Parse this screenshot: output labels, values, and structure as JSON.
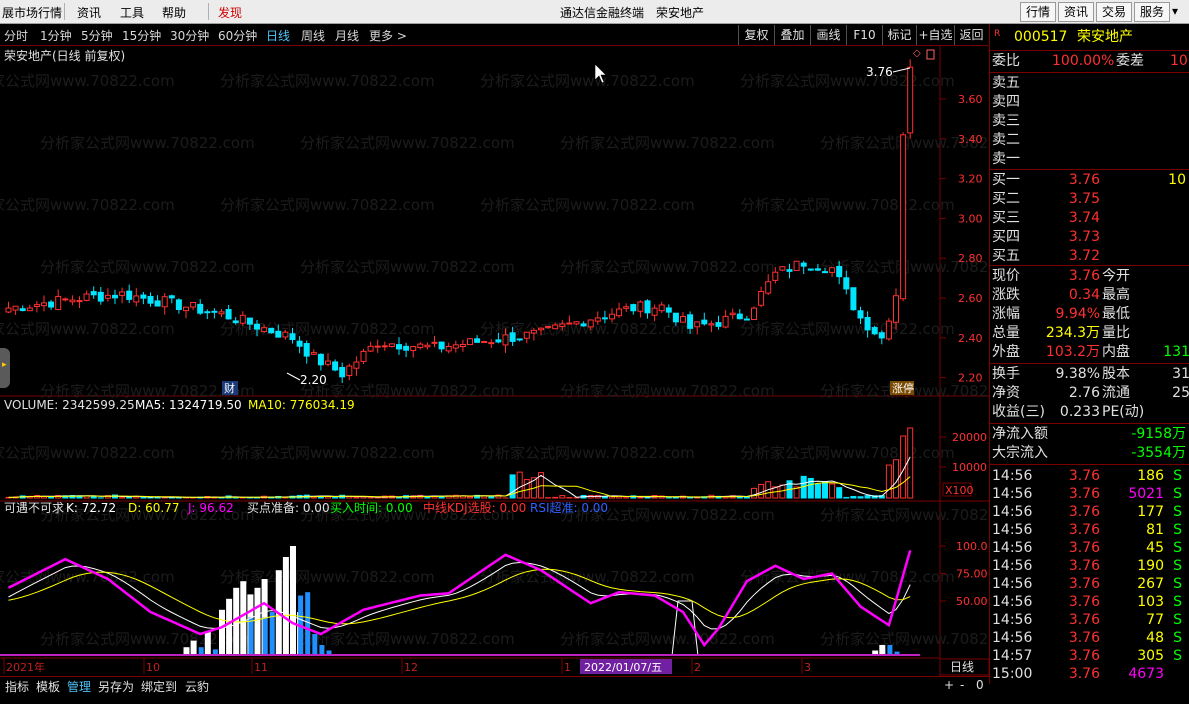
{
  "menu": {
    "items": [
      "展市场行情",
      "资讯",
      "工具",
      "帮助",
      "发现"
    ],
    "title_app": "通达信金融终端",
    "title_stock": "荣安地产",
    "right_buttons": [
      "行情",
      "资讯",
      "交易",
      "服务"
    ]
  },
  "toolbar": {
    "periods": [
      "分时",
      "1分钟",
      "5分钟",
      "15分钟",
      "30分钟",
      "60分钟",
      "日线",
      "周线",
      "月线",
      "更多 >"
    ],
    "active": "日线",
    "right": [
      "复权",
      "叠加",
      "画线",
      "F10",
      "标记",
      "+自选",
      "返回"
    ]
  },
  "chart": {
    "title": "荣安地产(日线 前复权)",
    "high_label": "3.76",
    "low_label": "2.20",
    "fin_badge": "财",
    "limit_badge": "涨停",
    "price_axis": [
      "3.60",
      "3.40",
      "3.20",
      "3.00",
      "2.80",
      "2.60",
      "2.40",
      "2.20"
    ],
    "volume": {
      "label": "VOLUME: 2342599.25",
      "ma5": "MA5: 1324719.50",
      "ma10": "MA10: 776034.19",
      "axis": [
        "20000",
        "10000"
      ],
      "unit": "X100"
    },
    "indicator": {
      "name": "可遇不可求",
      "k": "K: 72.72",
      "d": "D: 60.77",
      "j": "J: 96.62",
      "buy_ready": "买点准备: 0.00",
      "buy_time": "买入时间: 0.00",
      "kdj_select": "中线KDJ选股: 0.00",
      "rsi": "RSI超准: 0.00",
      "axis": [
        "100.0",
        "75.00",
        "50.00"
      ]
    },
    "timeline": [
      "2021年",
      "10",
      "11",
      "12",
      "1",
      "2022/01/07/五",
      "2",
      "3"
    ],
    "period_badge": "日线"
  },
  "bottombar": {
    "items": [
      "指标",
      "模板",
      "管理",
      "另存为",
      "绑定到",
      "云豹"
    ],
    "active": "管理",
    "controls": [
      "+",
      "-",
      "0"
    ]
  },
  "side": {
    "marker": "R",
    "code": "000517",
    "name": "荣安地产",
    "weibi_label": "委比",
    "weibi_value": "100.00%",
    "weicha_label": "委差",
    "weicha_value": "10",
    "sells": [
      "卖五",
      "卖四",
      "卖三",
      "卖二",
      "卖一"
    ],
    "buys": [
      {
        "label": "买一",
        "price": "3.76",
        "vol": "10"
      },
      {
        "label": "买二",
        "price": "3.75",
        "vol": ""
      },
      {
        "label": "买三",
        "price": "3.74",
        "vol": ""
      },
      {
        "label": "买四",
        "price": "3.73",
        "vol": ""
      },
      {
        "label": "买五",
        "price": "3.72",
        "vol": ""
      }
    ],
    "quote": [
      {
        "l": "现价",
        "v": "3.76",
        "l2": "今开",
        "v2": ""
      },
      {
        "l": "涨跌",
        "v": "0.34",
        "l2": "最高",
        "v2": ""
      },
      {
        "l": "涨幅",
        "v": "9.94%",
        "l2": "最低",
        "v2": ""
      },
      {
        "l": "总量",
        "v": "234.3万",
        "l2": "量比",
        "v2": ""
      },
      {
        "l": "外盘",
        "v": "103.2万",
        "l2": "内盘",
        "v2": "131"
      }
    ],
    "fundamentals": [
      {
        "l": "换手",
        "v": "9.38%",
        "l2": "股本",
        "v2": "31"
      },
      {
        "l": "净资",
        "v": "2.76",
        "l2": "流通",
        "v2": "25"
      },
      {
        "l": "收益(三)",
        "v": "0.233",
        "l2": "PE(动)",
        "v2": ""
      }
    ],
    "flows": [
      {
        "l": "净流入额",
        "v": "-9158万"
      },
      {
        "l": "大宗流入",
        "v": "-3554万"
      }
    ],
    "ticks": [
      {
        "t": "14:56",
        "p": "3.76",
        "v": "186",
        "s": "S"
      },
      {
        "t": "14:56",
        "p": "3.76",
        "v": "5021",
        "s": "S"
      },
      {
        "t": "14:56",
        "p": "3.76",
        "v": "177",
        "s": "S"
      },
      {
        "t": "14:56",
        "p": "3.76",
        "v": "81",
        "s": "S"
      },
      {
        "t": "14:56",
        "p": "3.76",
        "v": "45",
        "s": "S"
      },
      {
        "t": "14:56",
        "p": "3.76",
        "v": "190",
        "s": "S"
      },
      {
        "t": "14:56",
        "p": "3.76",
        "v": "267",
        "s": "S"
      },
      {
        "t": "14:56",
        "p": "3.76",
        "v": "103",
        "s": "S"
      },
      {
        "t": "14:56",
        "p": "3.76",
        "v": "77",
        "s": "S"
      },
      {
        "t": "14:56",
        "p": "3.76",
        "v": "48",
        "s": "S"
      },
      {
        "t": "14:57",
        "p": "3.76",
        "v": "305",
        "s": "S"
      },
      {
        "t": "15:00",
        "p": "3.76",
        "v": "4673",
        "s": ""
      }
    ]
  },
  "colors": {
    "up": "#ff3030",
    "down": "#00e5ff",
    "bg": "#000000",
    "border": "#7a0000",
    "k": "#ffffff",
    "d": "#ffff00",
    "j": "#ff00ff"
  }
}
